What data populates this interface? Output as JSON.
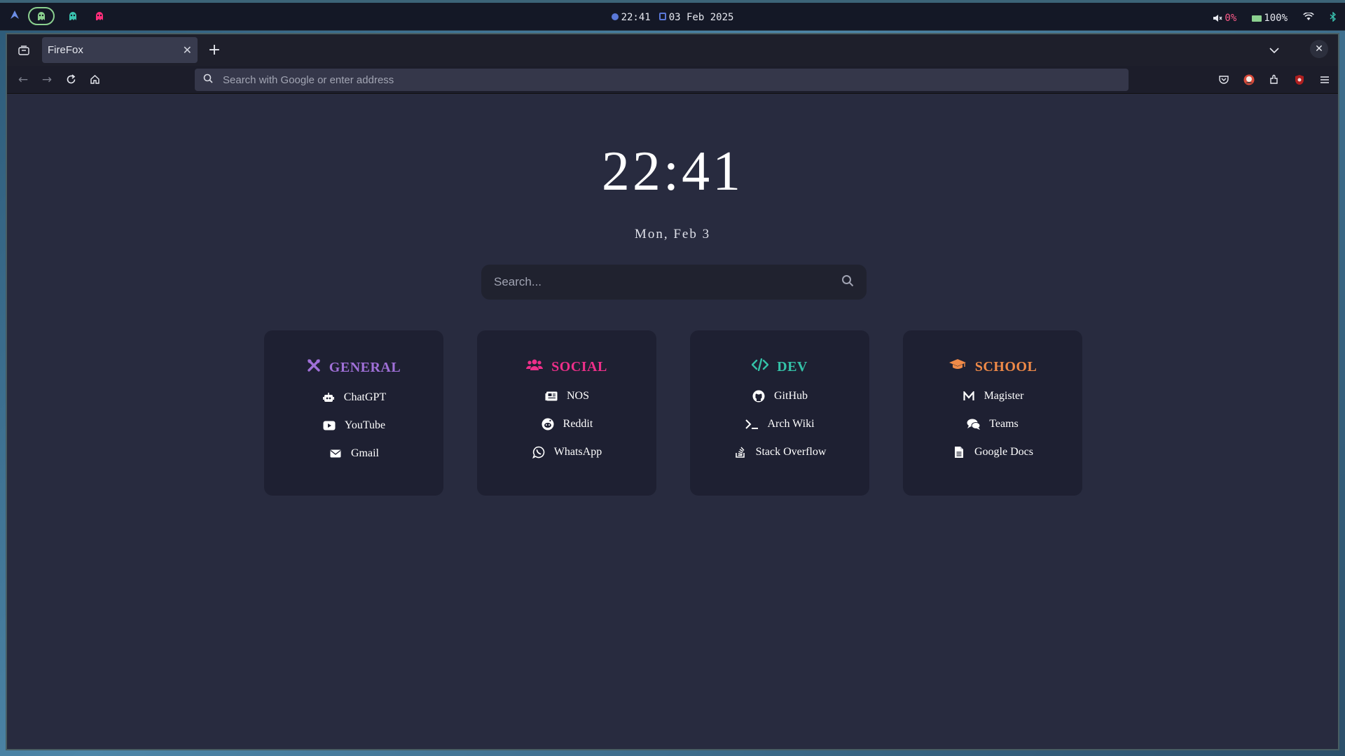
{
  "topbar": {
    "clock": "22:41",
    "date": "03 Feb 2025",
    "volume": "0%",
    "battery": "100%",
    "colors": {
      "accent_blue": "#5a78d8",
      "green": "#8bd08f",
      "pink": "#ff2d7a",
      "teal": "#3ac3b0"
    }
  },
  "browser": {
    "tab_title": "FireFox",
    "url_placeholder": "Search with Google or enter address"
  },
  "page": {
    "clock": "22:41",
    "date": "Mon, Feb 3",
    "search_placeholder": "Search...",
    "cards": [
      {
        "title": "GENERAL",
        "color": "#a070d8",
        "icon": "tools-icon",
        "links": [
          {
            "label": "ChatGPT",
            "icon": "robot-icon"
          },
          {
            "label": "YouTube",
            "icon": "youtube-icon"
          },
          {
            "label": "Gmail",
            "icon": "envelope-icon"
          }
        ]
      },
      {
        "title": "SOCIAL",
        "color": "#ee2f8a",
        "icon": "users-icon",
        "links": [
          {
            "label": "NOS",
            "icon": "newspaper-icon"
          },
          {
            "label": "Reddit",
            "icon": "reddit-icon"
          },
          {
            "label": "WhatsApp",
            "icon": "whatsapp-icon"
          }
        ]
      },
      {
        "title": "DEV",
        "color": "#34c2a8",
        "icon": "code-icon",
        "links": [
          {
            "label": "GitHub",
            "icon": "github-icon"
          },
          {
            "label": "Arch Wiki",
            "icon": "terminal-icon"
          },
          {
            "label": "Stack Overflow",
            "icon": "stackoverflow-icon"
          }
        ]
      },
      {
        "title": "SCHOOL",
        "color": "#f08a48",
        "icon": "graduation-cap-icon",
        "links": [
          {
            "label": "Magister",
            "icon": "m-icon"
          },
          {
            "label": "Teams",
            "icon": "comments-icon"
          },
          {
            "label": "Google Docs",
            "icon": "document-icon"
          }
        ]
      }
    ]
  }
}
